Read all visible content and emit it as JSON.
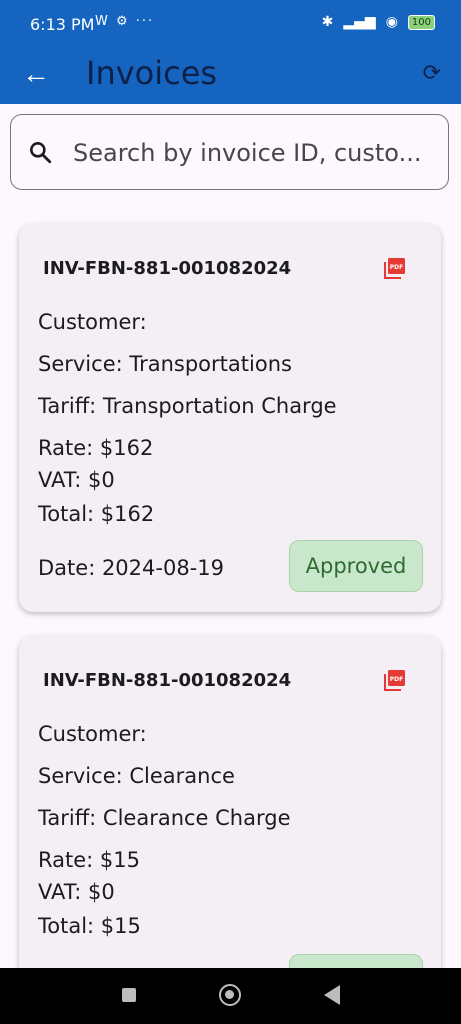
{
  "status_bar": {
    "time": "6:13 PM",
    "left_icons": "W ⚙ ···",
    "battery": "100"
  },
  "app_bar": {
    "title": "Invoices"
  },
  "search": {
    "placeholder": "Search by invoice ID, custo..."
  },
  "invoices": [
    {
      "id": "INV-FBN-881-001082024",
      "customer": "Customer:",
      "service": "Service: Transportations",
      "tariff": "Tariff: Transportation Charge",
      "rate": "Rate: $162",
      "vat": "VAT: $0",
      "total": "Total: $162",
      "date": "Date: 2024-08-19",
      "status": "Approved"
    },
    {
      "id": "INV-FBN-881-001082024",
      "customer": "Customer:",
      "service": "Service: Clearance",
      "tariff": "Tariff: Clearance Charge",
      "rate": "Rate: $15",
      "vat": "VAT: $0",
      "total": "Total: $15"
    }
  ],
  "colors": {
    "app_bar": "#1565c0",
    "status_approved_bg": "#c9e7cb",
    "pdf_icon": "#e53935"
  }
}
